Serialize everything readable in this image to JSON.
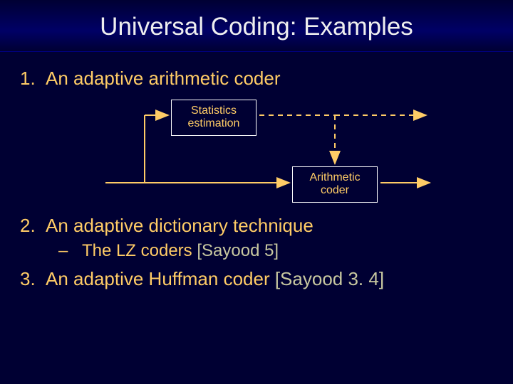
{
  "title": "Universal Coding: Examples",
  "items": [
    {
      "num": "1.",
      "text": "An adaptive arithmetic coder"
    },
    {
      "num": "2.",
      "text": "An adaptive dictionary technique"
    },
    {
      "num": "3.",
      "text": "An adaptive Huffman coder ",
      "ref": "[Sayood 3. 4]"
    }
  ],
  "subitem": {
    "dash": "–",
    "text": "The LZ coders ",
    "ref": "[Sayood 5]"
  },
  "diagram": {
    "box1_line1": "Statistics",
    "box1_line2": "estimation",
    "box2_line1": "Arithmetic",
    "box2_line2": "coder"
  }
}
